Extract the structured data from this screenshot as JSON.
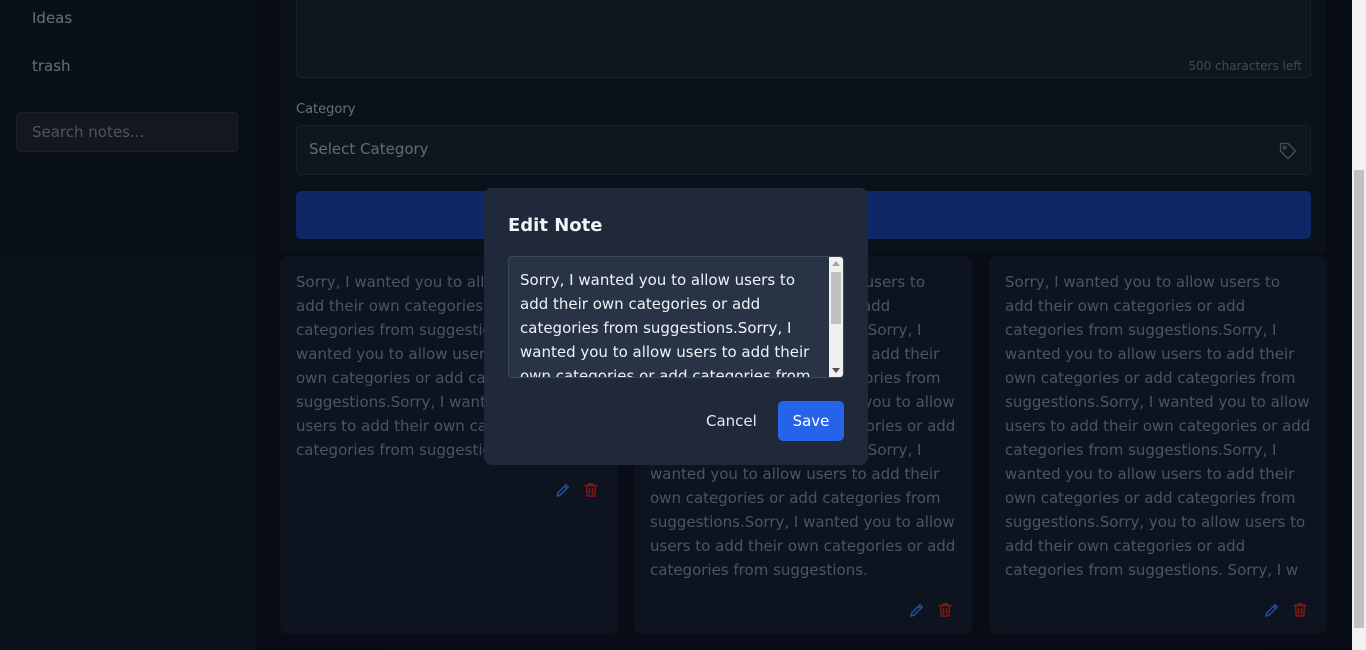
{
  "sidebar": {
    "items": [
      {
        "label": "Ideas"
      },
      {
        "label": "trash"
      }
    ],
    "search_placeholder": "Search notes..."
  },
  "form": {
    "chars_left": "500 characters left",
    "category_label": "Category",
    "category_placeholder": "Select Category"
  },
  "notes": [
    {
      "text": "Sorry, I wanted you to allow users to add their own categories or add categories from suggestions.Sorry, I wanted you to allow users to add their own categories or add categories from suggestions.Sorry, I wanted you to allow users to add their own categories or add categories from suggestions."
    },
    {
      "text": "Sorry, I wanted you to allow users to add their own categories or add categories from suggestions.Sorry, I wanted you to allow users to add their own categories or add categories from suggestions.Sorry, I wanted you to allow users to add their own categories or add categories from suggestions.Sorry, I wanted you to allow users to add their own categories or add categories from suggestions.Sorry, I wanted you to allow users to add their own categories or add categories from suggestions."
    },
    {
      "text": "Sorry, I wanted you to allow users to add their own categories or add categories from suggestions.Sorry, I wanted you to allow users to add their own categories or add categories from suggestions.Sorry, I wanted you to allow users to add their own categories or add categories from suggestions.Sorry, I wanted you to allow users to add their own categories or add categories from suggestions.Sorry, you to allow users to add their own categories or add categories from suggestions. Sorry, I w"
    }
  ],
  "modal": {
    "title": "Edit Note",
    "textarea_value": "Sorry, I wanted you to allow users to add their own categories or add categories from suggestions.Sorry, I wanted you to allow users to add their own categories or add categories from",
    "cancel_label": "Cancel",
    "save_label": "Save"
  },
  "colors": {
    "accent": "#2563eb",
    "edit_icon": "#3b82f6",
    "delete_icon": "#dc2626"
  },
  "icons": {
    "category": "tag-icon",
    "edit": "pencil-icon",
    "delete": "trash-icon"
  }
}
